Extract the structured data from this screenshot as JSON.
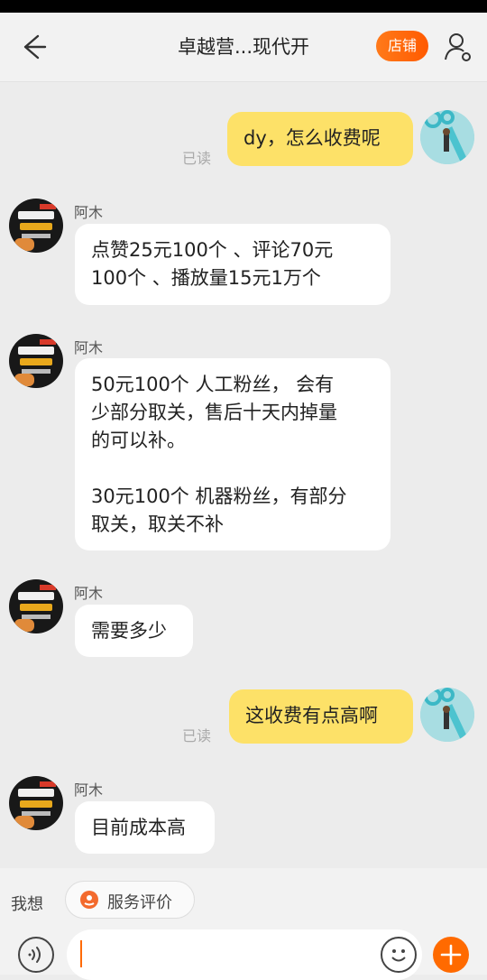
{
  "header": {
    "title": "卓越营...现代开",
    "shop_button": "店铺",
    "back_icon": "back-arrow-icon",
    "user_icon": "user-settings-icon"
  },
  "chat": {
    "messages": [
      {
        "from": "me",
        "text": "dy，怎么收费呢",
        "read": "已读"
      },
      {
        "from": "shop",
        "name": "阿木",
        "text_lines": [
          "点赞25元100个 、评论70元",
          "100个 、播放量15元1万个"
        ]
      },
      {
        "from": "shop",
        "name": "阿木",
        "text_lines": [
          "50元100个 人工粉丝， 会有",
          "少部分取关，售后十天内掉量",
          "的可以补。",
          "",
          "30元100个 机器粉丝，有部分",
          "取关，取关不补"
        ]
      },
      {
        "from": "shop",
        "name": "阿木",
        "text": "需要多少"
      },
      {
        "from": "me",
        "text": "这收费有点高啊",
        "read": "已读"
      },
      {
        "from": "shop",
        "name": "阿木",
        "text": "目前成本高"
      }
    ]
  },
  "bottom": {
    "quick_label": "我想",
    "chip_label": "服务评价",
    "input_value": "",
    "icons": [
      "voice-icon",
      "emoji-icon",
      "plus-icon"
    ]
  },
  "colors": {
    "accent": "#ff6a00",
    "my_bubble": "#fde168",
    "background": "#ececec"
  }
}
